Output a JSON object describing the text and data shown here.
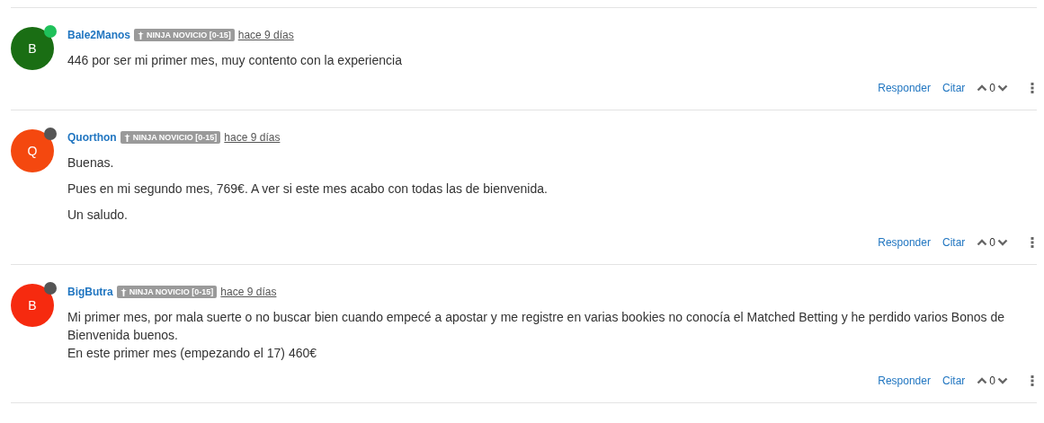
{
  "posts": [
    {
      "avatar_letter": "B",
      "color": "#1a6e14",
      "online": true,
      "username": "Bale2Manos",
      "badge": "NINJA NOVICIO [0-15]",
      "time": "hace 9 días",
      "paragraphs": [
        [
          "446 por ser mi primer mes, muy contento con la experiencia"
        ]
      ],
      "reply": "Responder",
      "quote": "Citar",
      "votes": "0"
    },
    {
      "avatar_letter": "Q",
      "color": "#f4480f",
      "online": false,
      "username": "Quorthon",
      "badge": "NINJA NOVICIO [0-15]",
      "time": "hace 9 días",
      "paragraphs": [
        [
          "Buenas."
        ],
        [
          "Pues en mi segundo mes, 769€. A ver si este mes acabo con todas las de bienvenida."
        ],
        [
          "Un saludo."
        ]
      ],
      "reply": "Responder",
      "quote": "Citar",
      "votes": "0"
    },
    {
      "avatar_letter": "B",
      "color": "#f62a0f",
      "online": false,
      "username": "BigButra",
      "badge": "NINJA NOVICIO [0-15]",
      "time": "hace 9 días",
      "paragraphs": [
        [
          "Mi primer mes, por mala suerte o no buscar bien cuando empecé a apostar y me registre en varias bookies no conocía el Matched Betting y he perdido varios Bonos de Bienvenida buenos.",
          "En este primer mes (empezando el 17) 460€"
        ]
      ],
      "reply": "Responder",
      "quote": "Citar",
      "votes": "0"
    }
  ]
}
